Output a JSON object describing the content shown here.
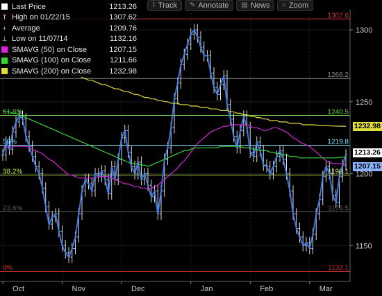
{
  "toolbar": {
    "items": [
      {
        "label": "Track",
        "icon": "chart-icon"
      },
      {
        "label": "Annotate",
        "icon": "pencil-icon"
      },
      {
        "label": "News",
        "icon": "news-icon"
      },
      {
        "label": "Zoom",
        "icon": "search-icon"
      }
    ]
  },
  "legend": [
    {
      "label": "Last Price",
      "value": "1213.26",
      "swatch": "#ffffff",
      "marker": "box"
    },
    {
      "label": "High on 01/22/15",
      "value": "1307.62",
      "swatch": "",
      "marker": "T"
    },
    {
      "label": "Average",
      "value": "1209.76",
      "swatch": "",
      "marker": "+"
    },
    {
      "label": "Low on 11/07/14",
      "value": "1132.16",
      "swatch": "",
      "marker": "⊥"
    },
    {
      "label": "SMAVG (50) on Close",
      "value": "1207.15",
      "swatch": "#d428d4",
      "marker": "box"
    },
    {
      "label": "SMAVG (100) on Close",
      "value": "1211.66",
      "swatch": "#3ad43a",
      "marker": "box"
    },
    {
      "label": "SMAVG (200) on Close",
      "value": "1232.98",
      "swatch": "#e0dc3c",
      "marker": "box"
    }
  ],
  "price_tags": [
    {
      "value": 1232.98,
      "label": "1232.98",
      "color": "#e0dc3c"
    },
    {
      "value": 1213.26,
      "label": "1213.26",
      "color": "#ffffff"
    },
    {
      "value": 1207.15,
      "label": "1207.15",
      "color": "#8ab4ff"
    }
  ],
  "colors": {
    "price": "#3f7ff0",
    "sma50": "#d428d4",
    "sma100": "#3ad43a",
    "sma200": "#e0dc3c"
  },
  "chart_data": {
    "type": "line",
    "ylim": [
      1128,
      1314
    ],
    "y_ticks": [
      1150,
      1200,
      1250,
      1300
    ],
    "x_labels": [
      {
        "label": "Oct",
        "t": 0
      },
      {
        "label": "Nov",
        "t": 18
      },
      {
        "label": "Dec",
        "t": 36
      },
      {
        "label": "Jan",
        "t": 57
      },
      {
        "label": "Feb",
        "t": 75
      },
      {
        "label": "Mar",
        "t": 93
      }
    ],
    "fib_levels": [
      {
        "label": "0%",
        "value": 1132.1,
        "right_label": "1132.1",
        "color": "#d03030"
      },
      {
        "label": "23.6%",
        "value": 1173.5,
        "right_label": "1173.5",
        "color": "#555555"
      },
      {
        "label": "38.2%",
        "value": 1199.1,
        "right_label": "1199.1",
        "color": "#b8e04a"
      },
      {
        "label": "50%",
        "value": 1219.8,
        "right_label": "1219.8",
        "color": "#7fe0ff"
      },
      {
        "label": "61.8%",
        "value": 1240.5,
        "right_label": "1240.5",
        "color": "#6ac84a"
      },
      {
        "label": "76.4%",
        "value": 1266.2,
        "right_label": "1266.2",
        "color": "#888888"
      },
      {
        "label": "100%",
        "value": 1307.6,
        "right_label": "1307.6",
        "color": "#d03030"
      }
    ],
    "series": [
      {
        "name": "Last Price",
        "values": [
          1213,
          1222,
          1217,
          1229,
          1236,
          1240,
          1238,
          1226,
          1219,
          1212,
          1205,
          1200,
          1190,
          1177,
          1165,
          1170,
          1172,
          1160,
          1150,
          1145,
          1142,
          1148,
          1156,
          1172,
          1188,
          1196,
          1193,
          1188,
          1200,
          1198,
          1202,
          1196,
          1186,
          1205,
          1196,
          1210,
          1225,
          1230,
          1215,
          1205,
          1200,
          1208,
          1196,
          1200,
          1192,
          1184,
          1188,
          1172,
          1188,
          1210,
          1218,
          1232,
          1252,
          1263,
          1276,
          1283,
          1290,
          1297,
          1300,
          1295,
          1288,
          1282,
          1282,
          1270,
          1260,
          1255,
          1262,
          1268,
          1248,
          1238,
          1226,
          1218,
          1230,
          1240,
          1232,
          1215,
          1212,
          1222,
          1216,
          1206,
          1205,
          1200,
          1205,
          1212,
          1216,
          1210,
          1200,
          1188,
          1172,
          1162,
          1156,
          1150,
          1152,
          1148,
          1158,
          1172,
          1182,
          1198,
          1205,
          1200,
          1185,
          1180,
          1198,
          1206,
          1213
        ]
      },
      {
        "name": "SMAVG (50) on Close",
        "values": [
          1218,
          1218,
          1218,
          1219,
          1219,
          1219,
          1219,
          1219,
          1218,
          1217,
          1216,
          1215,
          1214,
          1212,
          1210,
          1209,
          1207,
          1205,
          1203,
          1201,
          1199,
          1199,
          1198,
          1197,
          1197,
          1197,
          1197,
          1197,
          1197,
          1198,
          1198,
          1198,
          1198,
          1197,
          1196,
          1195,
          1194,
          1193,
          1193,
          1192,
          1191,
          1191,
          1190,
          1190,
          1189,
          1190,
          1191,
          1192,
          1194,
          1196,
          1198,
          1200,
          1202,
          1204,
          1207,
          1209,
          1212,
          1215,
          1218,
          1221,
          1223,
          1225,
          1227,
          1229,
          1230,
          1231,
          1232,
          1233,
          1233,
          1234,
          1234,
          1234,
          1234,
          1234,
          1234,
          1233,
          1232,
          1232,
          1231,
          1230,
          1230,
          1231,
          1232,
          1232,
          1231,
          1230,
          1229,
          1227,
          1225,
          1224,
          1222,
          1221,
          1220,
          1219,
          1217,
          1215,
          1213,
          1211,
          1209,
          1208,
          1207,
          1207,
          1207,
          1207,
          1207.15
        ]
      },
      {
        "name": "SMAVG (100) on Close",
        "values": [
          1244,
          1243,
          1243,
          1242,
          1242,
          1241,
          1240,
          1239,
          1238,
          1237,
          1236,
          1235,
          1234,
          1233,
          1232,
          1231,
          1230,
          1229,
          1228,
          1227,
          1226,
          1225,
          1224,
          1223,
          1222,
          1221,
          1220,
          1219,
          1218,
          1217,
          1216,
          1215,
          1214,
          1213,
          1212,
          1211,
          1210,
          1209,
          1208,
          1207,
          1207,
          1207,
          1206,
          1206,
          1205,
          1206,
          1207,
          1208,
          1209,
          1210,
          1211,
          1212,
          1213,
          1214,
          1215,
          1216,
          1216,
          1217,
          1218,
          1218,
          1218,
          1218,
          1218,
          1218,
          1218,
          1218,
          1219,
          1219,
          1219,
          1219,
          1219,
          1219,
          1219,
          1218,
          1218,
          1218,
          1217,
          1217,
          1216,
          1216,
          1216,
          1215,
          1215,
          1214,
          1214,
          1213,
          1213,
          1212,
          1212,
          1212,
          1211,
          1211,
          1211,
          1211,
          1211,
          1211,
          1211,
          1211,
          1211,
          1211,
          1211,
          1211,
          1211.3,
          1211.5,
          1211.66
        ]
      },
      {
        "name": "SMAVG (200) on Close",
        "values": [
          1283,
          1282,
          1282,
          1281,
          1280,
          1280,
          1279,
          1278,
          1278,
          1277,
          1276,
          1276,
          1275,
          1274,
          1274,
          1273,
          1272,
          1272,
          1271,
          1270,
          1270,
          1269,
          1268,
          1268,
          1267,
          1266,
          1265,
          1265,
          1264,
          1263,
          1262,
          1262,
          1261,
          1260,
          1259,
          1259,
          1258,
          1257,
          1257,
          1256,
          1255,
          1255,
          1254,
          1253,
          1253,
          1252,
          1252,
          1251,
          1251,
          1250,
          1250,
          1249,
          1249,
          1249,
          1248,
          1248,
          1248,
          1247,
          1247,
          1247,
          1246,
          1246,
          1246,
          1245,
          1245,
          1245,
          1244,
          1244,
          1244,
          1243,
          1243,
          1242,
          1242,
          1241,
          1241,
          1240,
          1240,
          1239,
          1239,
          1238,
          1238,
          1237,
          1237,
          1237,
          1236,
          1236,
          1236,
          1235,
          1235,
          1235,
          1235,
          1234,
          1234,
          1234,
          1234,
          1233.8,
          1233.6,
          1233.5,
          1233.4,
          1233.3,
          1233.2,
          1233.1,
          1233.05,
          1233.0,
          1232.98
        ]
      }
    ]
  }
}
